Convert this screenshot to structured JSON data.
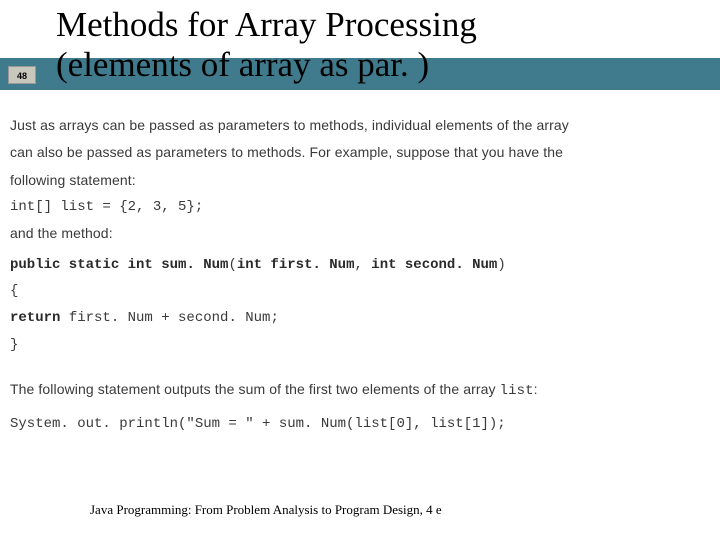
{
  "slide": {
    "number": "48",
    "title_line1": "Methods for Array Processing",
    "title_line2": "(elements of array as par. )"
  },
  "body": {
    "p1_a": "Just as arrays can be passed as parameters to methods, individual elements of the array",
    "p1_b": "can also be passed as parameters to methods.  For example, suppose that you have the",
    "p1_c": "following statement:",
    "decl": "int[] list = {2, 3, 5};",
    "andmethod": "and the method:",
    "sig_kw1": "public static int ",
    "sig_name": "sum. Num",
    "sig_open": "(",
    "sig_kw2": "int ",
    "sig_p1": "first. Num",
    "sig_comma": ",  ",
    "sig_kw3": "int ",
    "sig_p2": "second. Num",
    "sig_close": ")",
    "brace_open": "{",
    "ret_kw": "    return ",
    "ret_expr": "first. Num + second. Num;",
    "brace_close": "}",
    "p2": "The following statement outputs the sum of the first two elements of the array ",
    "p2_code": "list",
    "p2_end": ":",
    "sysout": "System. out. println(\"Sum = \" + sum. Num(list[0], list[1]);"
  },
  "footer": {
    "text": "Java Programming: From Problem Analysis to Program Design, 4 e"
  }
}
